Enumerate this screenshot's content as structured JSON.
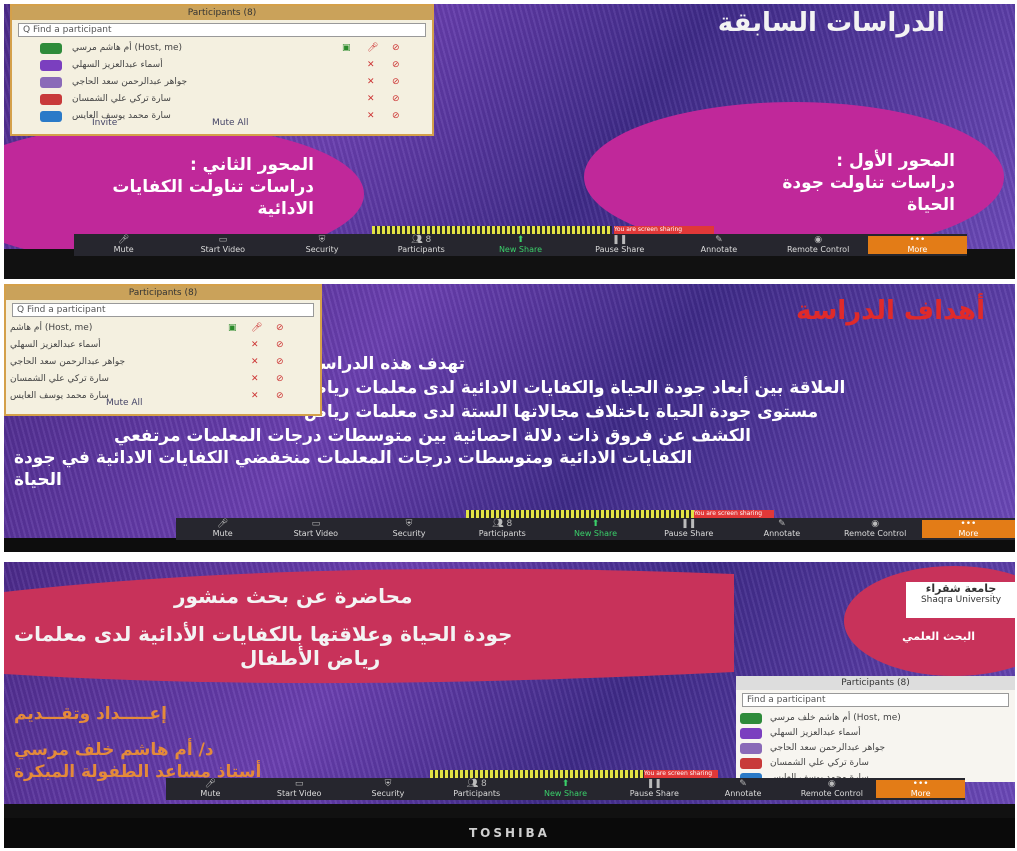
{
  "panel1": {
    "title": "الدراسات السابقة",
    "ellipse_right": [
      "المحور الأول :",
      "دراسات تناولت جودة",
      "الحياة"
    ],
    "ellipse_left": [
      "المحور الثاني :",
      "دراسات تناولت الكفايات",
      "الادائية"
    ],
    "participants": {
      "title": "Participants (8)",
      "search": "Q Find a participant",
      "rows": [
        {
          "name": "أم هاشم مرسي (Host, me)"
        },
        {
          "name": "أسماء عبدالعزيز السهلي"
        },
        {
          "name": "جواهر عبدالرحمن سعد الحاجي"
        },
        {
          "name": "سارة تركي علي الشمسان"
        },
        {
          "name": "سارة محمد يوسف العايس"
        }
      ],
      "invite": "Invite",
      "mute_all": "Mute All"
    },
    "share_label": "You are screen sharing"
  },
  "panel2": {
    "title": "أهداف الدراسة",
    "lines": [
      "تهدف هذه الدراسة إلى التعرف على :",
      "العلاقة بين أبعاد جودة الحياة والكفايات الادائية لدى معلمات رياض",
      "مستوى جودة الحياة باختلاف مجالاتها الستة لدى معلمات رياض",
      "الكشف عن فروق ذات دلالة احصائية بين متوسطات درجات المعلمات مرتفعي",
      "الكفايات الادائية ومتوسطات درجات المعلمات منخفضي الكفايات الادائية في جودة",
      "الحياة"
    ],
    "participants": {
      "title": "Participants (8)",
      "search": "Q Find a participant",
      "rows": [
        {
          "name": "أم هاشم (Host, me)"
        },
        {
          "name": "أسماء عبدالعزيز السهلي"
        },
        {
          "name": "جواهر عبدالرحمن سعد الحاجي"
        },
        {
          "name": "سارة تركي علي الشمسان"
        },
        {
          "name": "سارة محمد يوسف العايس"
        }
      ],
      "mute_all": "Mute All"
    },
    "share_label": "You are screen sharing"
  },
  "panel3": {
    "lecture_title": "محاضرة عن بحث منشور",
    "research_title_1": "جودة الحياة وعلاقتها بالكفايات الأدائية لدى معلمات",
    "research_title_2": "رياض الأطفال",
    "prepared": "إعـــــداد وتقـــديم",
    "presenter": "د/ أم هاشم خلف مرسي",
    "presenter_role": "أستاذ مساعد الطفولة المبكرة",
    "logo_text": "جامعة شقراء",
    "logo_sub": "Shaqra University",
    "dept": "البحث العلمي",
    "participants": {
      "title": "Participants (8)",
      "search": "Find a participant",
      "rows": [
        {
          "name": "أم هاشم خلف مرسي (Host, me)"
        },
        {
          "name": "أسماء عبدالعزيز السهلي"
        },
        {
          "name": "جواهر عبدالرحمن سعد الحاجي"
        },
        {
          "name": "سارة تركي علي الشمسان"
        },
        {
          "name": "سارة محمد يوسف العايس"
        }
      ]
    },
    "share_label": "You are screen sharing",
    "brand": "TOSHIBA"
  },
  "toolbar": {
    "mute": "Mute",
    "start_video": "Start Video",
    "security": "Security",
    "participants": "Participants",
    "participants_count": "8",
    "new_share": "New Share",
    "pause_share": "Pause Share",
    "annotate": "Annotate",
    "remote_control": "Remote Control",
    "more": "More"
  },
  "colors": {
    "slide_purple": "#5a35a0",
    "ellipse_magenta": "#c0289a",
    "banner_red": "#c8325a",
    "toolbar": "#26262e",
    "more_orange": "#e37c17"
  }
}
